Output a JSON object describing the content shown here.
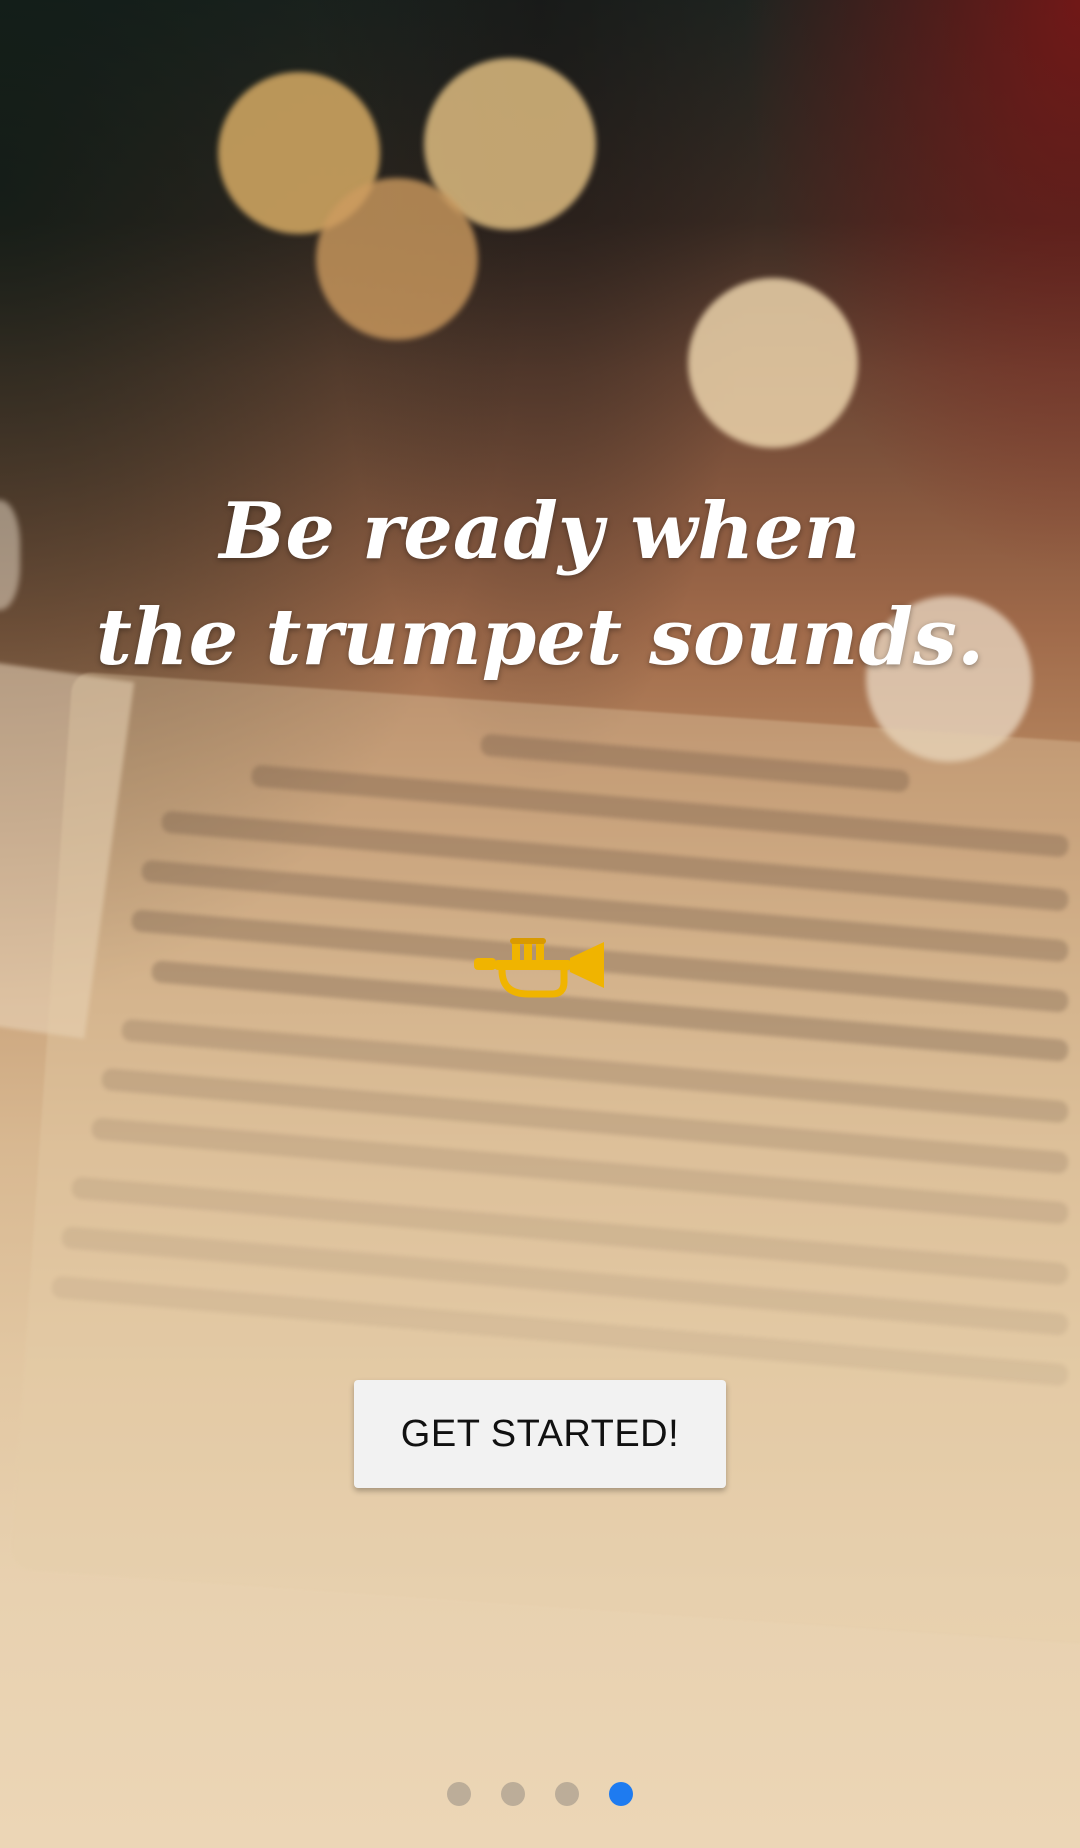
{
  "onboarding": {
    "headline_line1": "Be ready when",
    "headline_line2": "the trumpet sounds.",
    "cta_label": "GET STARTED!",
    "icon": "trumpet-icon",
    "background": "bible-open-luke-2-bokeh",
    "page_indicator": {
      "total": 4,
      "active_index": 3,
      "active_color": "#1e7bf0",
      "inactive_color": "#a0968c"
    }
  }
}
